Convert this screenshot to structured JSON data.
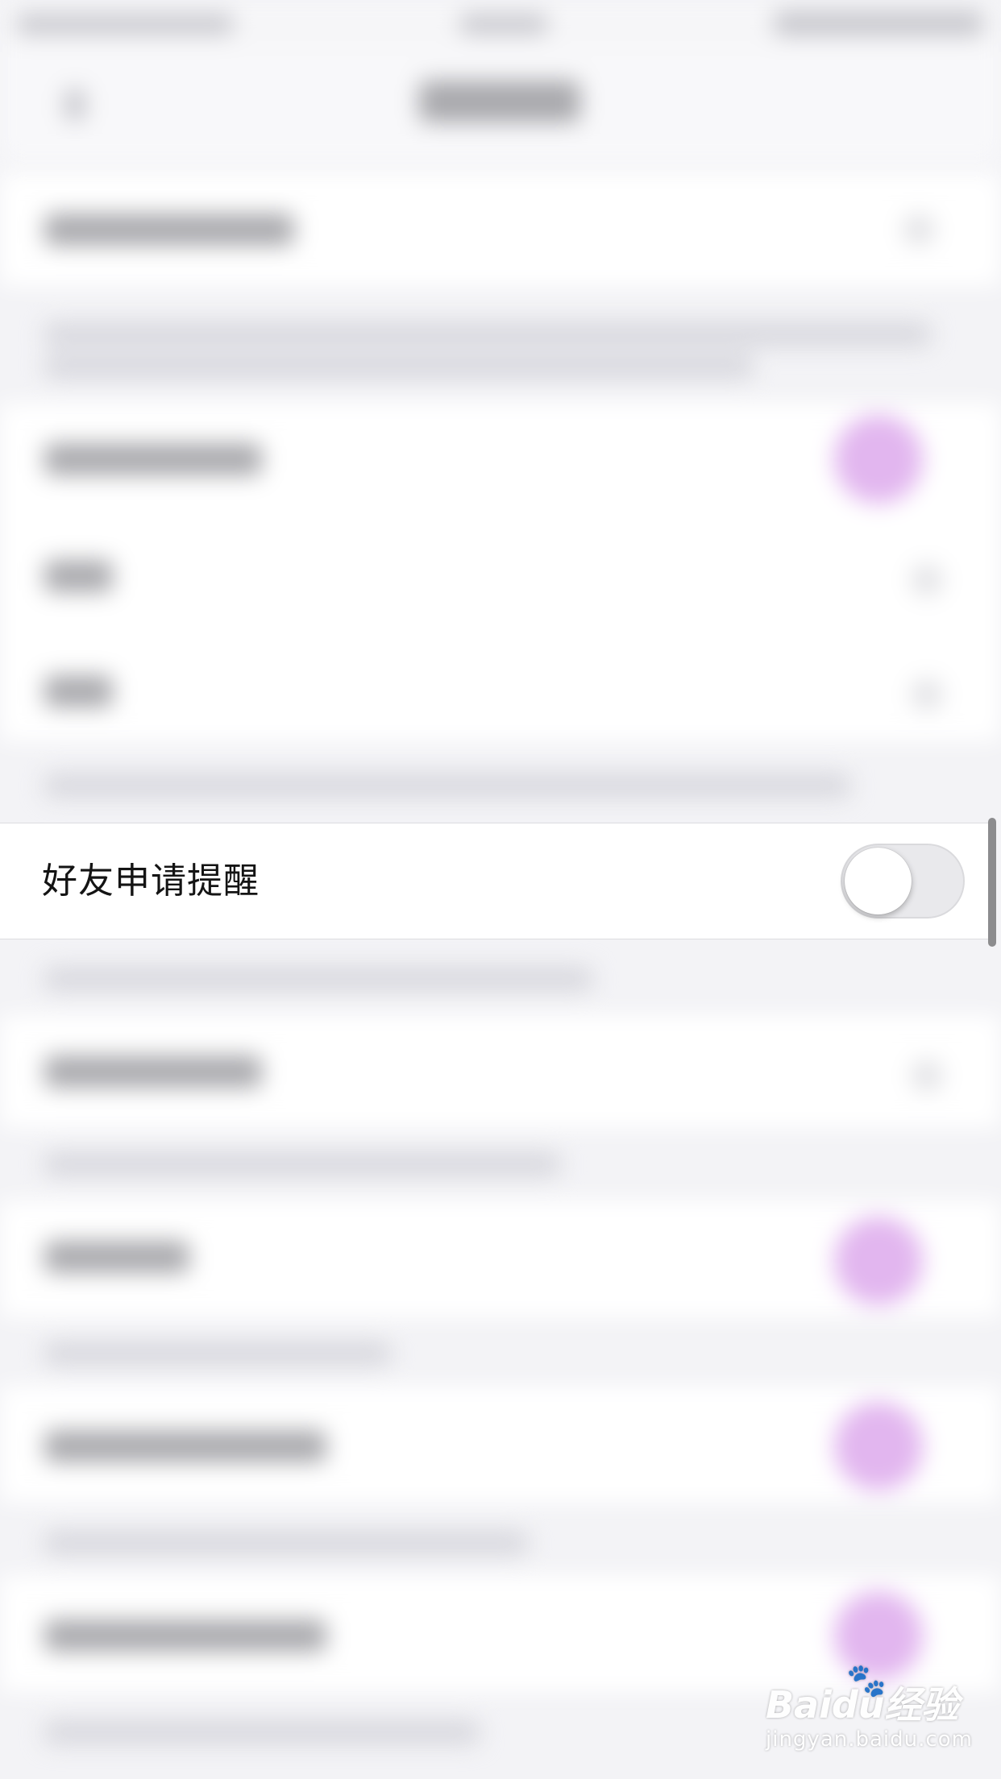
{
  "settings": {
    "friend_request_reminder": {
      "label": "好友申请提醒",
      "enabled": false
    }
  },
  "watermark": {
    "logo_text": "Baidu经验",
    "url_text": "jingyan.baidu.com"
  },
  "colors": {
    "background": "#f3f3f6",
    "row_background": "#ffffff",
    "toggle_off": "#e9e9ec",
    "blurred_switch_accent": "#e2b6ef"
  }
}
